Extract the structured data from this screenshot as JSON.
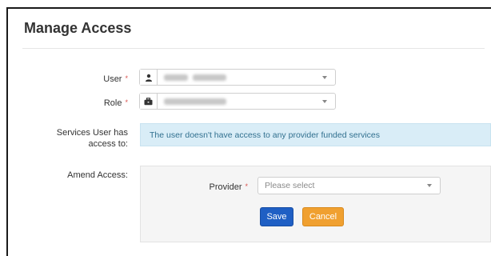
{
  "page": {
    "title": "Manage Access"
  },
  "form": {
    "user": {
      "label": "User",
      "required_marker": "*",
      "icon": "user-icon"
    },
    "role": {
      "label": "Role",
      "required_marker": "*",
      "icon": "briefcase-icon"
    },
    "services": {
      "label_line1": "Services User has",
      "label_line2": "access to:",
      "message": "The user doesn't have access to any provider funded services"
    },
    "amend": {
      "label": "Amend Access:",
      "provider": {
        "label": "Provider",
        "required_marker": "*",
        "placeholder": "Please select"
      },
      "save_label": "Save",
      "cancel_label": "Cancel"
    }
  },
  "colors": {
    "info_bg": "#d9edf7",
    "info_text": "#31708f",
    "primary": "#1f5fc4",
    "warning": "#f0a030",
    "required": "#d9534f"
  }
}
